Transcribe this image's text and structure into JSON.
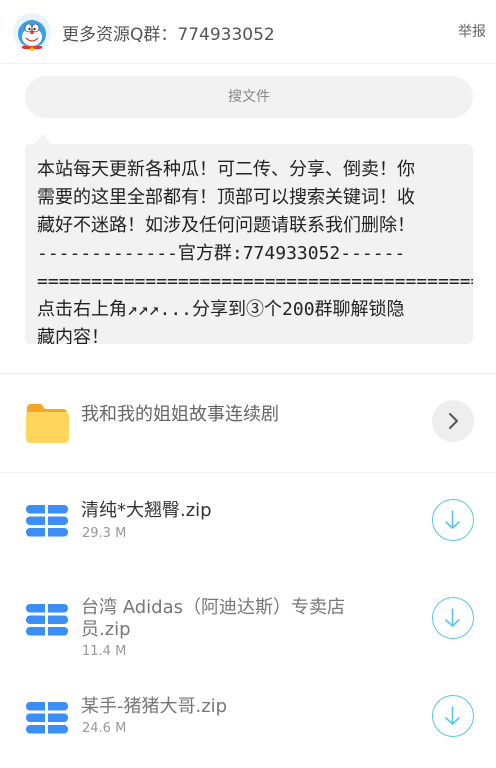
{
  "header": {
    "title": "更多资源Q群：774933052",
    "report_label": "举报",
    "avatar_icon": "doraemon-avatar"
  },
  "search": {
    "placeholder": "搜文件"
  },
  "notice": {
    "text": "本站每天更新各种瓜！可二传、分享、倒卖！你\n需要的这里全部都有！顶部可以搜索关键词！收\n藏好不迷路！如涉及任何问题请联系我们删除！\n-------------官方群:774933052------\n=========================================\n点击右上角↗↗↗...分享到③个200群聊解锁隐\n藏内容！"
  },
  "folder": {
    "title": "我和我的姐姐故事连续剧",
    "icon": "folder-icon",
    "action_icon": "chevron-right-icon"
  },
  "files": [
    {
      "name": "清纯*大翘臀.zip",
      "size": "29.3 M",
      "icon": "zip-file-icon",
      "action_icon": "download-icon"
    },
    {
      "name_line1": "台湾 Adidas（阿迪达斯）专卖店",
      "name_line2": "员.zip",
      "size": "11.4 M",
      "icon": "zip-file-icon",
      "action_icon": "download-icon"
    },
    {
      "name": "某手-猪猪大哥.zip",
      "size": "24.6 M",
      "icon": "zip-file-icon",
      "action_icon": "download-icon"
    }
  ],
  "colors": {
    "accent": "#3a8ef6",
    "download_ring": "#57c6e8",
    "folder": "#ffd55c"
  }
}
